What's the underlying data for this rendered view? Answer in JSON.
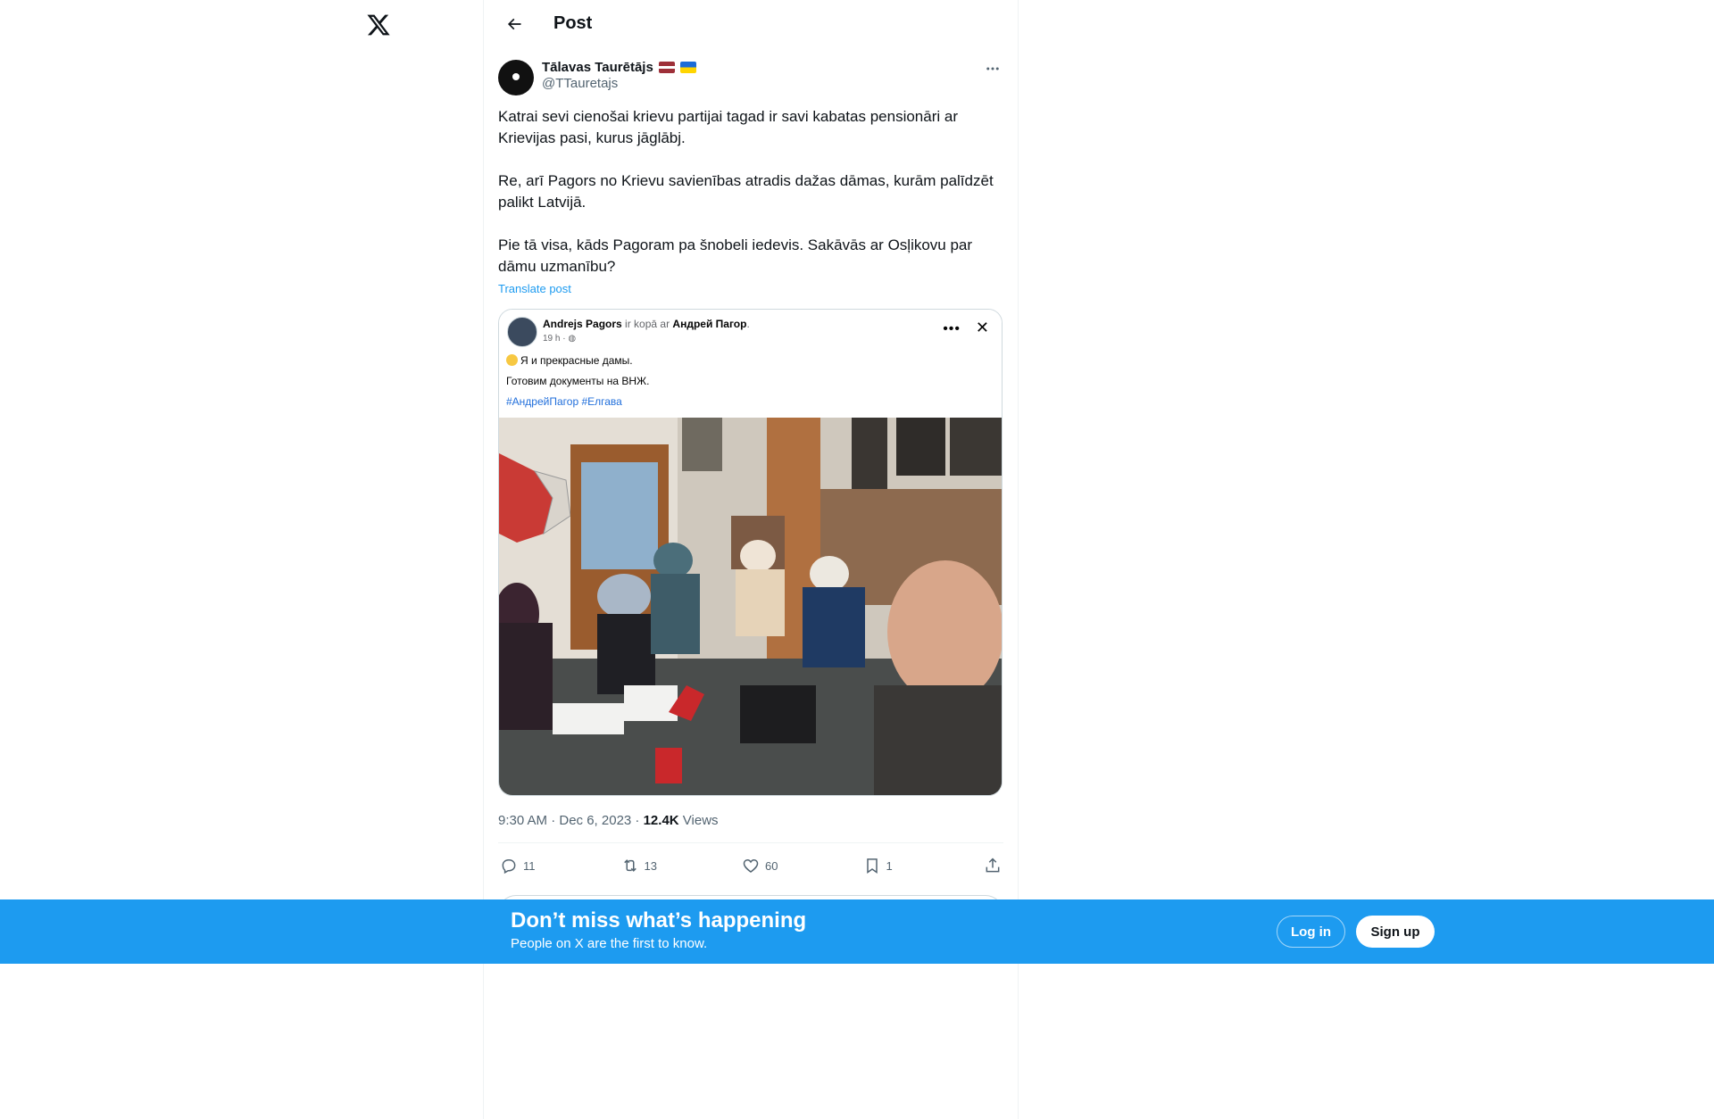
{
  "topbar": {
    "title": "Post"
  },
  "post": {
    "author_name": "Tālavas Taurētājs",
    "author_handle": "@TTauretajs",
    "text": "Katrai sevi cienošai krievu partijai tagad ir savi kabatas pensionāri ar Krievijas pasi, kurus jāglābj.\n\nRe, arī Pagors no Krievu savienības atradis dažas dāmas, kurām palīdzēt palikt Latvijā.\n\nPie tā visa, kāds Pagoram pa šnobeli iedevis. Sakāvās ar Osļikovu par dāmu uzmanību?",
    "translate_label": "Translate post",
    "timestamp": "9:30 AM · Dec 6, 2023 · ",
    "views_count": "12.4K",
    "views_label": " Views"
  },
  "embedded": {
    "author": "Andrejs Pagors",
    "with_text": " ir kopā ar ",
    "with_name": "Андрей Пагор",
    "with_end": ".",
    "time": "19 h · ",
    "line1": "Я и прекрасные дамы.",
    "line2": "Готовим документы на ВНЖ.",
    "tags": "#АндрейПагор #Елгава",
    "dots": "•••",
    "close": "✕"
  },
  "actions": {
    "replies": "11",
    "reposts": "13",
    "likes": "60",
    "bookmarks": "1"
  },
  "banner": {
    "title": "Don’t miss what’s happening",
    "subtitle": "People on X are the first to know.",
    "login": "Log in",
    "signup": "Sign up"
  },
  "colors": {
    "accent": "#1d9bf0",
    "text": "#0f1419",
    "muted": "#536471"
  }
}
